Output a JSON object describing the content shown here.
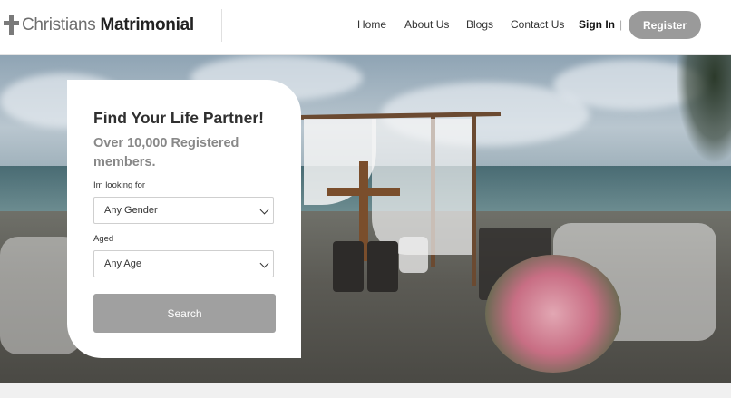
{
  "brand": {
    "name_light": "Christians",
    "name_bold": "Matrimonial"
  },
  "nav": {
    "items": [
      "Home",
      "About Us",
      "Blogs",
      "Contact Us"
    ],
    "signin": "Sign In",
    "separator": "|",
    "register": "Register"
  },
  "search_card": {
    "title": "Find Your Life Partner!",
    "subtitle": "Over 10,000 Registered members.",
    "gender_label": "Im looking for",
    "gender_value": "Any Gender",
    "age_label": "Aged",
    "age_value": "Any Age",
    "search_button": "Search"
  },
  "colors": {
    "accent_gray": "#9a9a9a",
    "title": "#2f2f2f",
    "subtitle": "#888888"
  }
}
